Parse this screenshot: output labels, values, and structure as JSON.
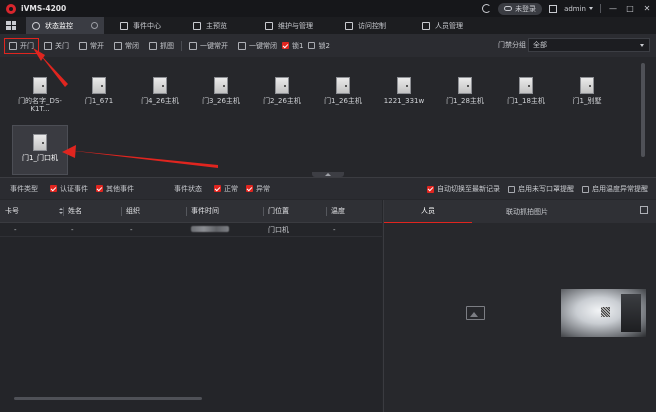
{
  "app": {
    "title": "iVMS-4200"
  },
  "titlebar": {
    "login_status": "未登录",
    "username": "admin",
    "window_controls": [
      "—",
      "□",
      "✕"
    ]
  },
  "modules": [
    {
      "label": "状态监控",
      "icon": "status-monitor-icon",
      "active": true
    },
    {
      "label": "事件中心",
      "icon": "event-center-icon"
    },
    {
      "label": "主预览",
      "icon": "main-view-icon"
    },
    {
      "label": "维护与管理",
      "icon": "maintenance-icon"
    },
    {
      "label": "访问控制",
      "icon": "access-control-icon"
    },
    {
      "label": "人员管理",
      "icon": "person-management-icon"
    }
  ],
  "toolbar": {
    "open": "开门",
    "close": "关门",
    "remain_open": "常开",
    "remain_closed": "常闭",
    "capture": "抓图",
    "all_remain_open": "一键常开",
    "all_remain_closed": "一键常闭",
    "lock1": "锁1",
    "lock2": "锁2",
    "group_label": "门禁分组",
    "group_value": "全部"
  },
  "doors": [
    {
      "name": "门的名字_DS-K1T..."
    },
    {
      "name": "门1_671"
    },
    {
      "name": "门4_26主机"
    },
    {
      "name": "门3_26主机"
    },
    {
      "name": "门2_26主机"
    },
    {
      "name": "门1_26主机"
    },
    {
      "name": "1221_331w"
    },
    {
      "name": "门1_28主机"
    },
    {
      "name": "门1_18主机"
    },
    {
      "name": "门1_别墅"
    },
    {
      "name": "门1_门口机",
      "selected": true
    }
  ],
  "filters": {
    "event_type_label": "事件类型",
    "auth_event": "认证事件",
    "other_event": "其他事件",
    "event_status_label": "事件状态",
    "normal": "正常",
    "abnormal": "异常",
    "auto_switch": "自动切换至最新记录",
    "enable_unclosed_alert": "启用未写口罩提醒",
    "enable_temp_alert": "启用温度异常提醒"
  },
  "event_table": {
    "columns": [
      "卡号",
      "姓名",
      "组织",
      "事件时间",
      "门位置",
      "温度"
    ],
    "rows": [
      {
        "card": "-",
        "name": "-",
        "org": "-",
        "time": "",
        "door": "门口机",
        "temp": "-"
      }
    ]
  },
  "right_panel": {
    "tabs": [
      "人员",
      "联动抓拍图片"
    ]
  },
  "colors": {
    "accent": "#e0251f",
    "background": "#26272b"
  }
}
